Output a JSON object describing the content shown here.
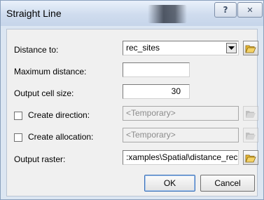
{
  "window": {
    "title": "Straight Line",
    "help_label": "?",
    "close_label": "✕"
  },
  "form": {
    "distance_to": {
      "label": "Distance to:",
      "value": "rec_sites"
    },
    "max_distance": {
      "label": "Maximum distance:",
      "value": ""
    },
    "cell_size": {
      "label": "Output cell size:",
      "value": "30"
    },
    "create_direction": {
      "label": "Create direction:",
      "value": "<Temporary>",
      "checked": false
    },
    "create_allocation": {
      "label": "Create allocation:",
      "value": "<Temporary>",
      "checked": false
    },
    "output_raster": {
      "label": "Output raster:",
      "value": ":xamples\\Spatial\\distance_rec"
    }
  },
  "buttons": {
    "ok": "OK",
    "cancel": "Cancel"
  },
  "icons": {
    "open": "folder-open-icon",
    "dropdown": "chevron-down-icon",
    "help": "help-icon",
    "close": "close-icon"
  },
  "colors": {
    "folder": "#e7b634",
    "title_bg": "#d1dff0",
    "client_bg": "#f0f0f0"
  }
}
